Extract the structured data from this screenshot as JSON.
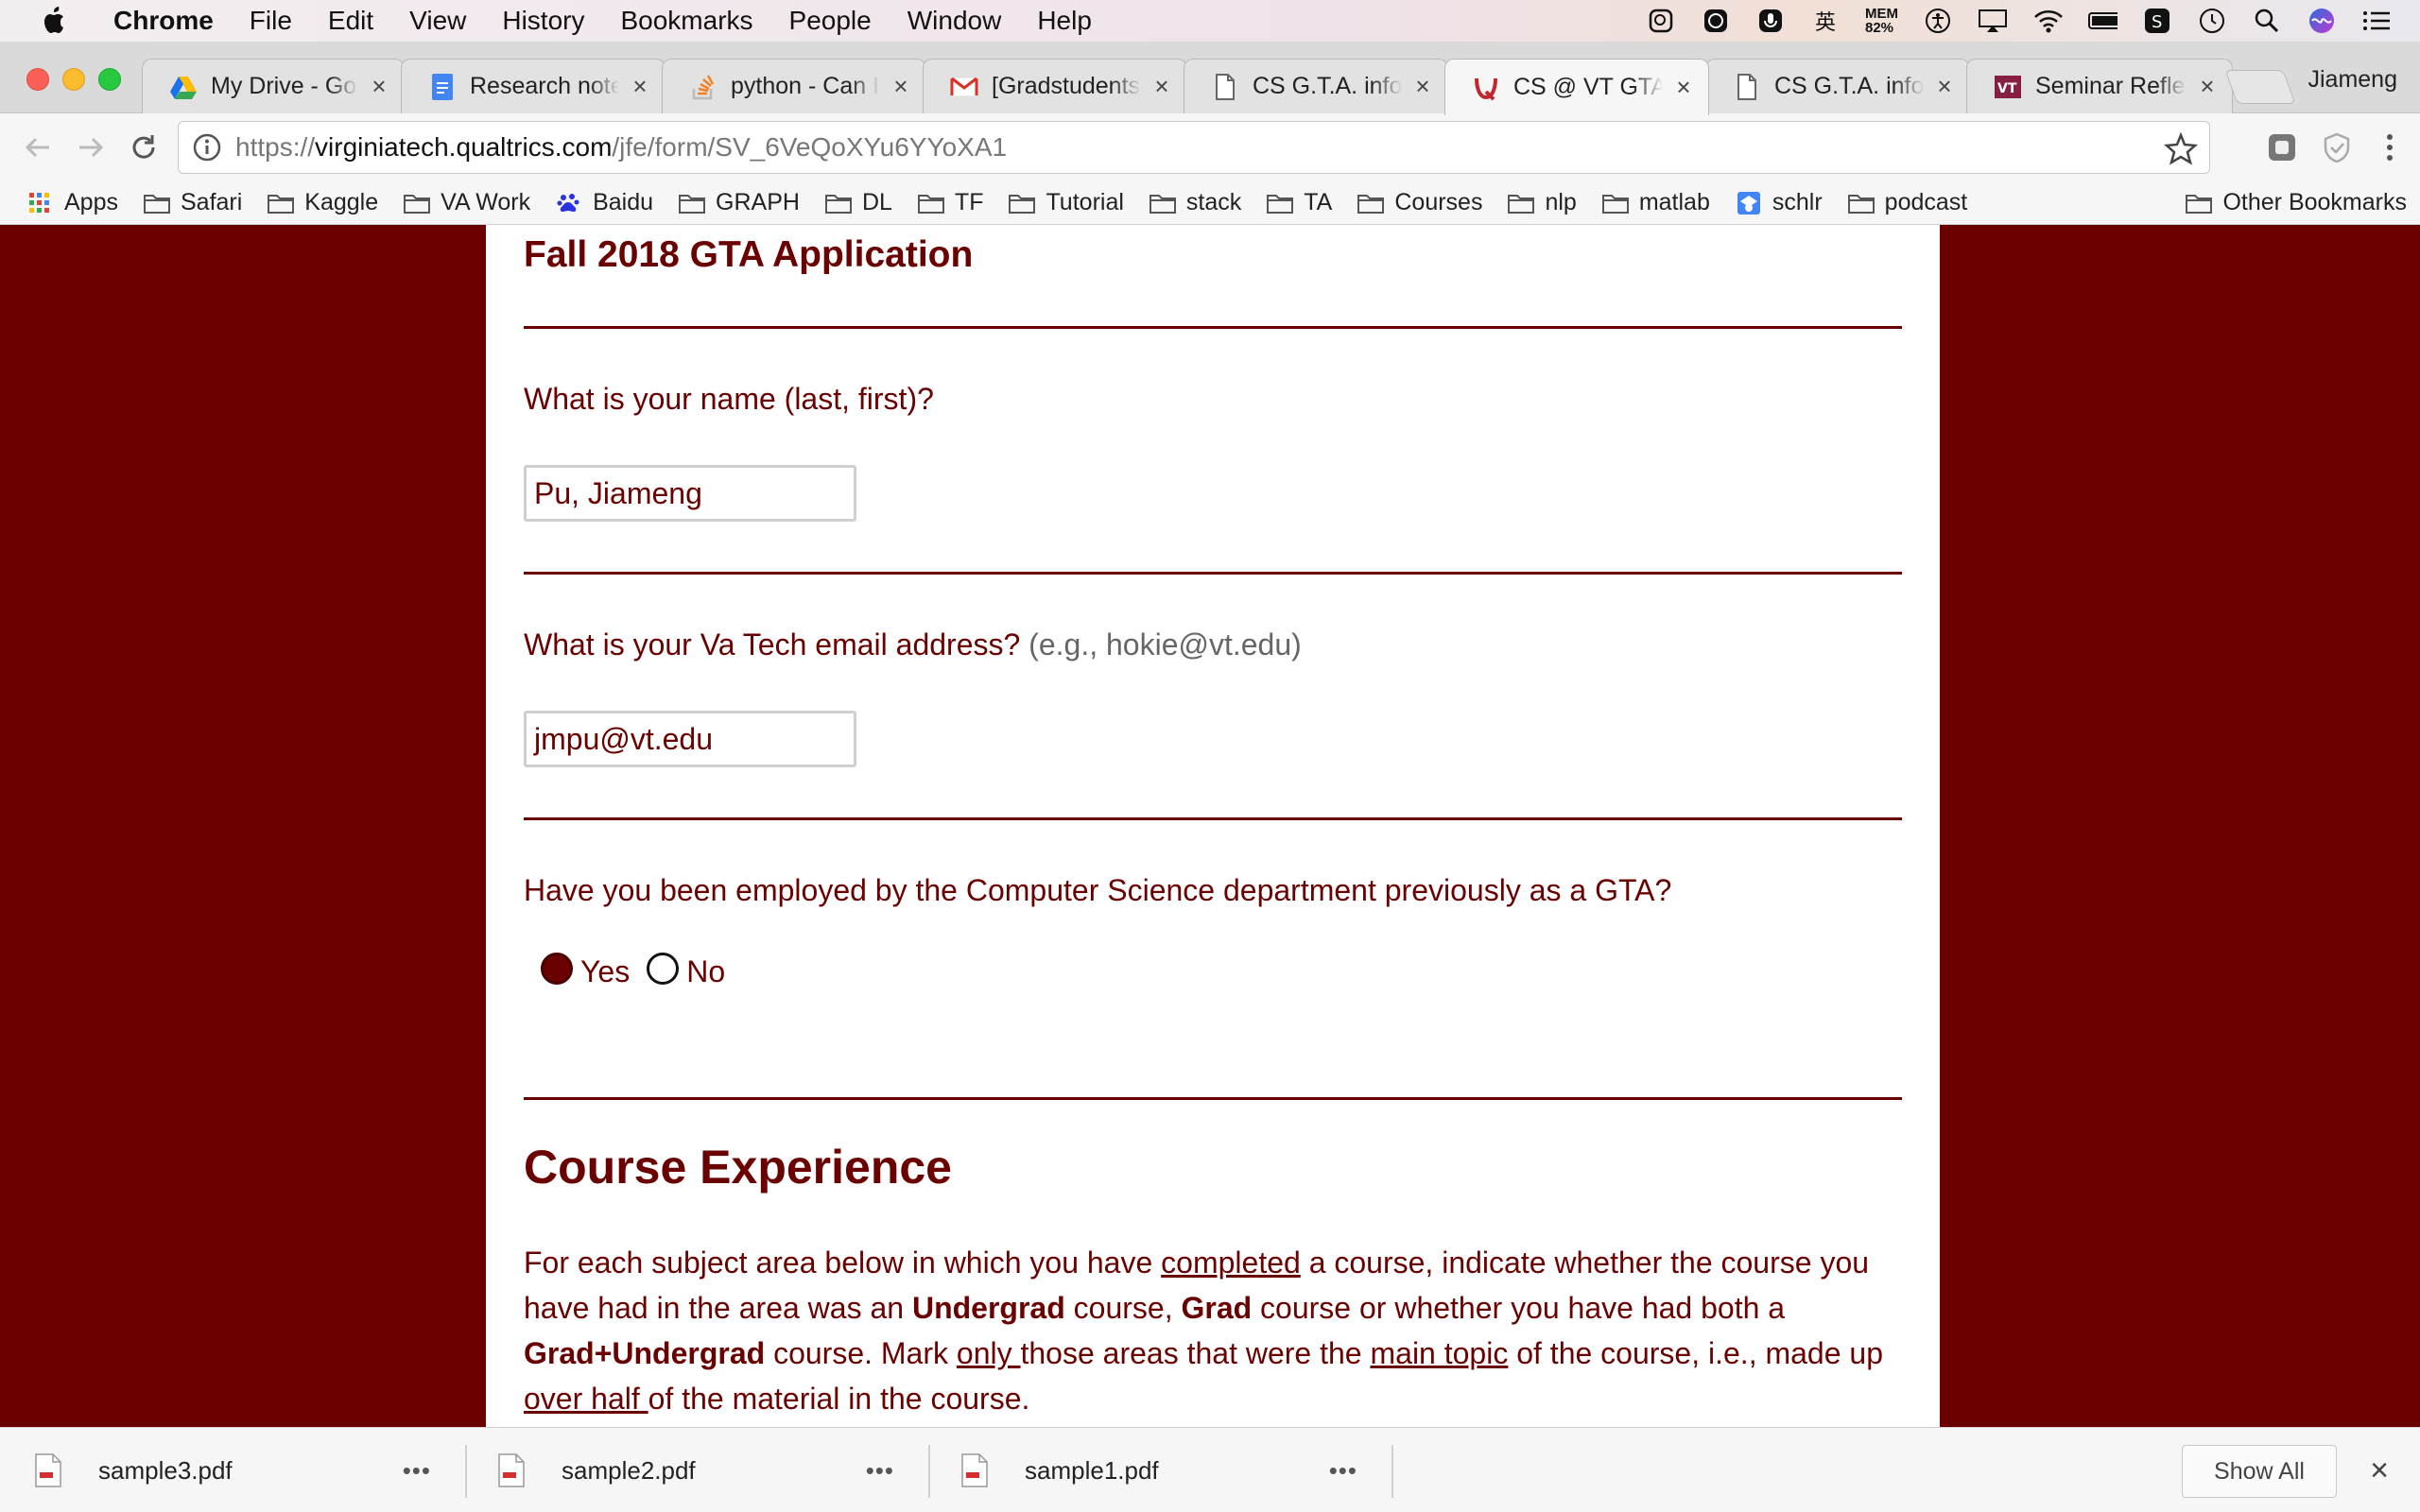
{
  "menubar": {
    "app": "Chrome",
    "items": [
      "File",
      "Edit",
      "View",
      "History",
      "Bookmarks",
      "People",
      "Window",
      "Help"
    ],
    "mem_label": "MEM",
    "mem_value": "82%",
    "ime_glyph": "英"
  },
  "tabs": [
    {
      "title": "My Drive - Google Drive",
      "icon": "google-drive-icon"
    },
    {
      "title": "Research notes",
      "icon": "google-docs-icon"
    },
    {
      "title": "python - Can I",
      "icon": "stackoverflow-icon"
    },
    {
      "title": "[Gradstudents]",
      "icon": "gmail-icon"
    },
    {
      "title": "CS G.T.A. information",
      "icon": "document-icon"
    },
    {
      "title": "CS @ VT GTA Application",
      "icon": "qualtrics-icon",
      "active": true
    },
    {
      "title": "CS G.T.A. information",
      "icon": "document-icon"
    },
    {
      "title": "Seminar Reflection",
      "icon": "vt-icon"
    }
  ],
  "profile_name": "Jiameng",
  "address": {
    "scheme": "https://",
    "host": "virginiatech.qualtrics.com",
    "path": "/jfe/form/SV_6VeQoXYu6YYoXA1"
  },
  "bookmarks": [
    "Apps",
    "Safari",
    "Kaggle",
    "VA Work",
    "Baidu",
    "GRAPH",
    "DL",
    "TF",
    "Tutorial",
    "stack",
    "TA",
    "Courses",
    "nlp",
    "matlab",
    "schlr",
    "podcast"
  ],
  "other_bookmarks": "Other Bookmarks",
  "form": {
    "title": "Fall 2018 GTA Application",
    "q_name": "What is your name (last, first)?",
    "name_value": "Pu, Jiameng",
    "q_email": "What is your Va Tech email address?",
    "q_email_hint": "(e.g., hokie@vt.edu)",
    "email_value": "jmpu@vt.edu",
    "q_employed": "Have you been employed by the Computer Science department previously as a GTA?",
    "opt_yes": "Yes",
    "opt_no": "No",
    "selected": "Yes",
    "section_title": "Course Experience",
    "instr": {
      "p1": "For each subject area below in which you have ",
      "u1": "completed",
      "p2": " a course, indicate whether the course you have had in the area was an ",
      "b1": "Undergrad",
      "p3": " course, ",
      "b2": "Grad",
      "p4": " course or whether you have had both a ",
      "b3": "Grad+Undergrad",
      "p5": " course. Mark ",
      "u2": "only ",
      "p6": "those areas that were the ",
      "u3": "main topic",
      "p7": " of the course, i.e., made up ",
      "u4": "over half ",
      "p8": "of the material in the course."
    }
  },
  "downloads": [
    {
      "file": "sample3.pdf"
    },
    {
      "file": "sample2.pdf"
    },
    {
      "file": "sample1.pdf"
    }
  ],
  "download_menu": "•••",
  "show_all": "Show All"
}
